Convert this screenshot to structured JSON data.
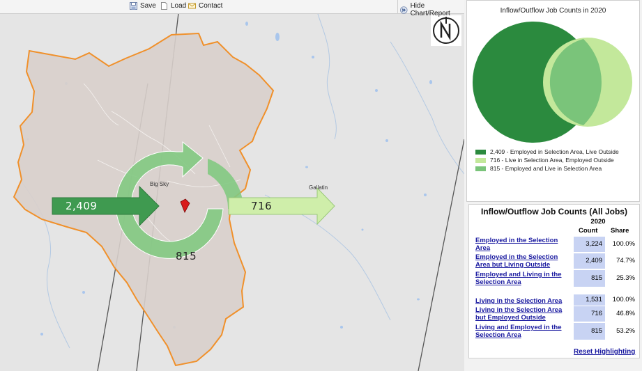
{
  "toolbar": {
    "save": "Save",
    "load": "Load",
    "contact": "Contact",
    "hide_chart": "Hide Chart/Report"
  },
  "map": {
    "inflow_count": "2,409",
    "outflow_count": "716",
    "internal_count": "815",
    "places": [
      "Big Sky",
      "Gallatin"
    ],
    "compass_icon": "north-arrow-icon",
    "colors": {
      "inflow": "#3f9a50",
      "outflow": "#cfeeaa",
      "internal": "#82c982",
      "boundary": "#f0902a",
      "marker": "#d91b1b"
    }
  },
  "venn": {
    "title": "Inflow/Outflow Job Counts in 2020",
    "legend": [
      {
        "label": "2,409 - Employed in Selection Area, Live Outside",
        "color": "#2b8a3e"
      },
      {
        "label": "716 - Live in Selection Area, Employed Outside",
        "color": "#c3e89b"
      },
      {
        "label": "815 - Employed and Live in Selection Area",
        "color": "#7ac47a"
      }
    ]
  },
  "table": {
    "title": "Inflow/Outflow Job Counts (All Jobs)",
    "year": "2020",
    "col_count": "Count",
    "col_share": "Share",
    "rows": [
      {
        "label": "Employed in the Selection Area",
        "count": "3,224",
        "share": "100.0%"
      },
      {
        "label": "Employed in the Selection Area but Living Outside",
        "count": "2,409",
        "share": "74.7%"
      },
      {
        "label": "Employed and Living in the Selection Area",
        "count": "815",
        "share": "25.3%"
      },
      {
        "label": "Living in the Selection Area",
        "count": "1,531",
        "share": "100.0%"
      },
      {
        "label": "Living in the Selection Area but Employed Outside",
        "count": "716",
        "share": "46.8%"
      },
      {
        "label": "Living and Employed in the Selection Area",
        "count": "815",
        "share": "53.2%"
      }
    ],
    "reset": "Reset Highlighting"
  }
}
